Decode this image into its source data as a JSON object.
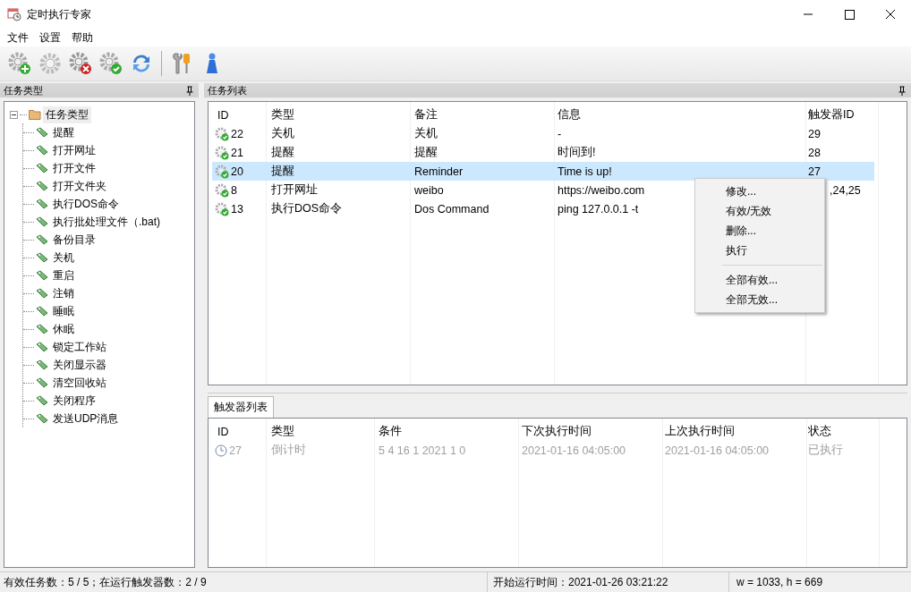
{
  "window": {
    "title": "定时执行专家"
  },
  "menu": [
    "文件",
    "设置",
    "帮助"
  ],
  "left_panel": {
    "title": "任务类型",
    "tree": {
      "label": "任务类型",
      "expanded": true,
      "children": [
        {
          "label": "提醒"
        },
        {
          "label": "打开网址"
        },
        {
          "label": "打开文件"
        },
        {
          "label": "打开文件夹"
        },
        {
          "label": "执行DOS命令"
        },
        {
          "label": "执行批处理文件（.bat)"
        },
        {
          "label": "备份目录"
        },
        {
          "label": "关机"
        },
        {
          "label": "重启"
        },
        {
          "label": "注销"
        },
        {
          "label": "睡眠"
        },
        {
          "label": "休眠"
        },
        {
          "label": "锁定工作站"
        },
        {
          "label": "关闭显示器"
        },
        {
          "label": "清空回收站"
        },
        {
          "label": "关闭程序"
        },
        {
          "label": "发送UDP消息"
        }
      ]
    }
  },
  "task_panel": {
    "title": "任务列表",
    "columns": [
      "ID",
      "类型",
      "备注",
      "信息",
      "触发器ID"
    ],
    "rows": [
      {
        "id": "22",
        "type": "关机",
        "note": "关机",
        "info": "-",
        "trigger_ids": "29",
        "enabled": true,
        "selected": false
      },
      {
        "id": "21",
        "type": "提醒",
        "note": "提醒",
        "info": "时间到!",
        "trigger_ids": "28",
        "enabled": true,
        "selected": false
      },
      {
        "id": "20",
        "type": "提醒",
        "note": "Reminder",
        "info": "Time is up!",
        "trigger_ids": "27",
        "enabled": true,
        "selected": true
      },
      {
        "id": "8",
        "type": "打开网址",
        "note": "weibo",
        "info": "https://weibo.com",
        "trigger_ids": ",24,25",
        "covered": true,
        "enabled": true,
        "selected": false
      },
      {
        "id": "13",
        "type": "执行DOS命令",
        "note": "Dos Command",
        "info": "ping 127.0.0.1 -t",
        "enabled": true,
        "selected": false
      }
    ]
  },
  "context_menu": {
    "items": [
      {
        "kind": "item",
        "label": "修改..."
      },
      {
        "kind": "item",
        "label": "有效/无效"
      },
      {
        "kind": "item",
        "label": "删除..."
      },
      {
        "kind": "item",
        "label": "执行"
      },
      {
        "kind": "separator"
      },
      {
        "kind": "item",
        "label": "全部有效..."
      },
      {
        "kind": "item",
        "label": "全部无效..."
      }
    ]
  },
  "trigger_panel": {
    "tabs": [
      {
        "label": "触发器列表",
        "selected": true
      }
    ],
    "columns": [
      "ID",
      "类型",
      "条件",
      "下次执行时间",
      "上次执行时间",
      "状态"
    ],
    "rows": [
      {
        "id": "27",
        "type": "倒计时",
        "condition": "5 4 16 1 2021 1 0",
        "next": "2021-01-16 04:05:00",
        "last": "2021-01-16 04:05:00",
        "status": "已执行",
        "greyed": true
      }
    ]
  },
  "status_bar": {
    "tasks": "有效任务数：5 / 5；在运行触发器数：2 / 9",
    "start_time": "开始运行时间：2021-01-26 03:21:22",
    "size": "w = 1033, h = 669"
  }
}
